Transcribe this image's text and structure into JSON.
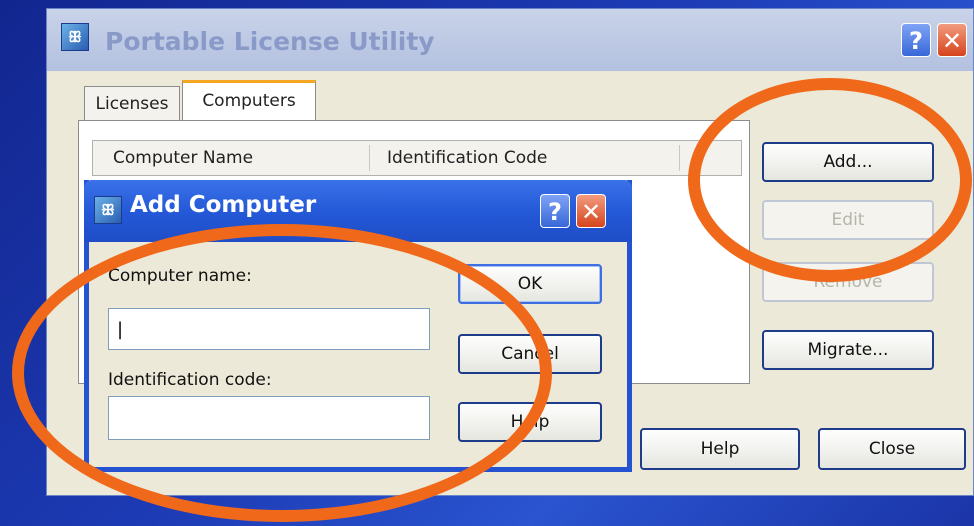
{
  "window": {
    "title": "Portable License Utility",
    "help_glyph": "?",
    "close_glyph": "✕",
    "icon_glyph": "ꕥ"
  },
  "tabs": [
    {
      "label": "Licenses",
      "active": false
    },
    {
      "label": "Computers",
      "active": true
    }
  ],
  "list": {
    "columns": [
      "Computer Name",
      "Identification Code"
    ]
  },
  "side_buttons": {
    "add": "Add...",
    "edit": "Edit",
    "remove": "Remove",
    "migrate": "Migrate..."
  },
  "footer_buttons": {
    "help": "Help",
    "close": "Close"
  },
  "dialog": {
    "title": "Add Computer",
    "help_glyph": "?",
    "close_glyph": "✕",
    "computer_name_label": "Computer name:",
    "computer_name_value": "|",
    "identification_code_label": "Identification code:",
    "identification_code_value": "",
    "ok": "OK",
    "cancel": "Cancel",
    "help": "Help"
  },
  "colors": {
    "background": "#1d3bb5",
    "annotation_highlight": "#f0691a",
    "dialog_titlebar": "#2459d8"
  }
}
